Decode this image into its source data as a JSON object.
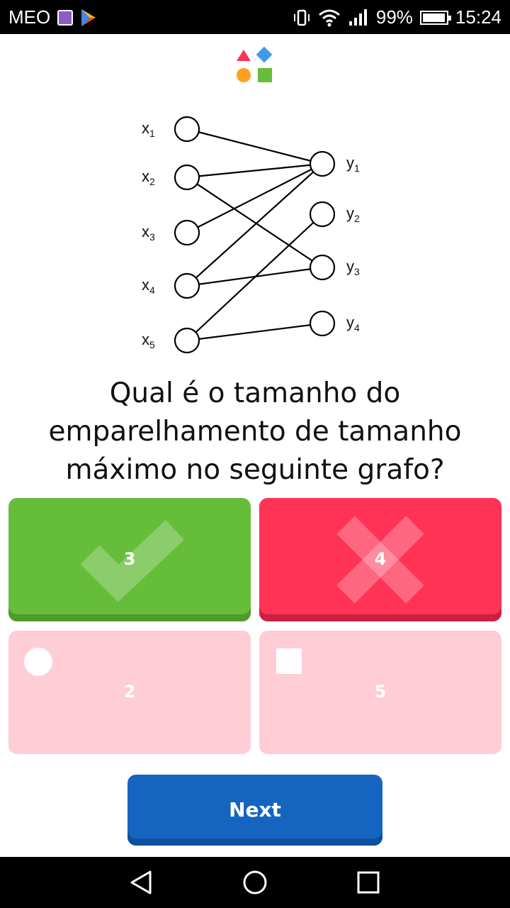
{
  "status_bar": {
    "carrier": "MEO",
    "battery": "99%",
    "time": "15:24"
  },
  "graph": {
    "left_nodes": [
      {
        "name": "x",
        "sub": "1"
      },
      {
        "name": "x",
        "sub": "2"
      },
      {
        "name": "x",
        "sub": "3"
      },
      {
        "name": "x",
        "sub": "4"
      },
      {
        "name": "x",
        "sub": "5"
      }
    ],
    "right_nodes": [
      {
        "name": "y",
        "sub": "1"
      },
      {
        "name": "y",
        "sub": "2"
      },
      {
        "name": "y",
        "sub": "3"
      },
      {
        "name": "y",
        "sub": "4"
      }
    ],
    "edges": [
      [
        "x1",
        "y1"
      ],
      [
        "x2",
        "y1"
      ],
      [
        "x2",
        "y3"
      ],
      [
        "x3",
        "y1"
      ],
      [
        "x4",
        "y1"
      ],
      [
        "x4",
        "y3"
      ],
      [
        "x5",
        "y2"
      ],
      [
        "x5",
        "y4"
      ]
    ]
  },
  "question": {
    "line1": "Qual é o tamanho do",
    "line2": "emparelhamento de tamanho",
    "line3": "máximo no seguinte grafo?"
  },
  "answers": [
    {
      "label": "3",
      "state": "correct",
      "color": "#66bd3a"
    },
    {
      "label": "4",
      "state": "wrong",
      "color": "#ff3355"
    },
    {
      "label": "2",
      "state": "unselected",
      "color": "#ffcdd5",
      "shape": "circle"
    },
    {
      "label": "5",
      "state": "unselected",
      "color": "#ffcdd5",
      "shape": "square"
    }
  ],
  "next_button": {
    "label": "Next",
    "color": "#1565c0"
  },
  "icons": {
    "logo": "shapes-logo-icon",
    "correct": "check-icon",
    "wrong": "cross-icon"
  }
}
